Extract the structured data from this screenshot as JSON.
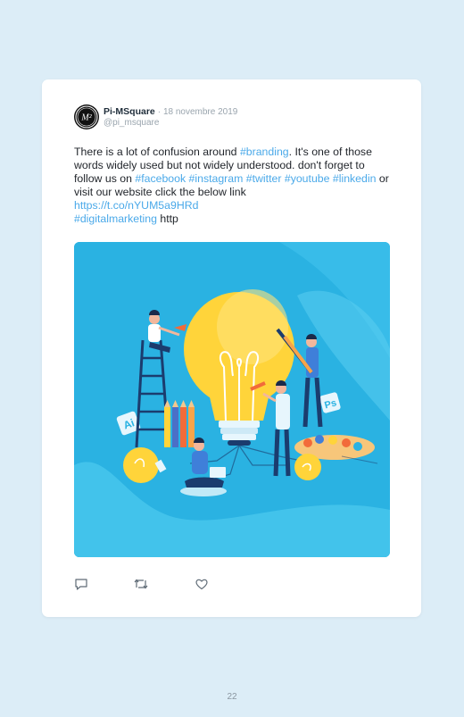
{
  "tweet": {
    "author_name": "Pi-MSquare",
    "separator": "·",
    "date": "18 novembre 2019",
    "handle": "@pi_msquare",
    "avatar_text": "M²",
    "text": {
      "t1": "There is a lot of confusion around ",
      "h_branding": "#branding",
      "t2": ". It's one of those words widely used but not widely understood. don't forget to follow us on ",
      "h_facebook": "#facebook",
      "h_instagram": "#instagram",
      "h_twitter": "#twitter",
      "h_youtube": "#youtube",
      "h_linkedin": "#linkedin",
      "t3": " or visit our website click the below link",
      "url": "https://t.co/nYUM5a9HRd",
      "h_digitalmarketing": "#digitalmarketing",
      "t4": " http"
    },
    "media": {
      "description_icon": "lightbulb-illustration",
      "badge_ai": "Ai",
      "badge_ps": "Ps"
    },
    "actions": [
      {
        "icon": "reply-icon"
      },
      {
        "icon": "retweet-icon"
      },
      {
        "icon": "like-icon"
      }
    ]
  },
  "page": {
    "number": "22"
  },
  "colors": {
    "background": "#dcedf7",
    "card": "#ffffff",
    "link": "#4aa9e9",
    "media_bg": "#2ab2e2",
    "bulb": "#ffd43a"
  }
}
